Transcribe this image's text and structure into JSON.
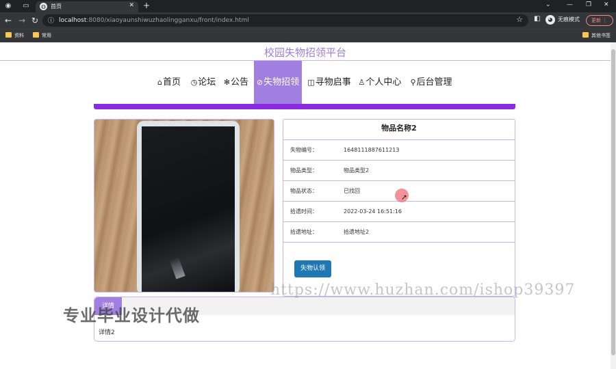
{
  "browser": {
    "tab_title": "首页",
    "url_host": "localhost",
    "url_rest": ":8080/xiaoyaunshiwuzhaolingganxu/front/index.html",
    "incognito_label": "无痕模式",
    "update_label": "更新",
    "bookmarks": [
      "资料",
      "常用"
    ],
    "other_bookmarks": "其他书签"
  },
  "site": {
    "title": "校园失物招领平台",
    "nav": [
      {
        "icon": "⌂",
        "label": "首页"
      },
      {
        "icon": "◷",
        "label": "论坛"
      },
      {
        "icon": "✻",
        "label": "公告"
      },
      {
        "icon": "⊘",
        "label": "失物招领"
      },
      {
        "icon": "◫",
        "label": "寻物启事"
      },
      {
        "icon": "♙",
        "label": "个人中心"
      },
      {
        "icon": "⚲",
        "label": "后台管理"
      }
    ]
  },
  "item": {
    "name": "物品名称2",
    "fields": [
      {
        "key": "失物编号：",
        "value": "1648111887611213"
      },
      {
        "key": "物品类型：",
        "value": "物品类型2"
      },
      {
        "key": "物品状态：",
        "value": "已找回"
      },
      {
        "key": "拾遗时间：",
        "value": "2022-03-24 16:51:16"
      },
      {
        "key": "拾遗地址：",
        "value": "拾遗地址2"
      }
    ],
    "claim_button": "失物认领"
  },
  "detail": {
    "tab_label": "详情",
    "text": "详情2"
  },
  "watermarks": {
    "url": "https://www.huzhan.com/ishop39397",
    "text": "专业毕业设计代做"
  }
}
